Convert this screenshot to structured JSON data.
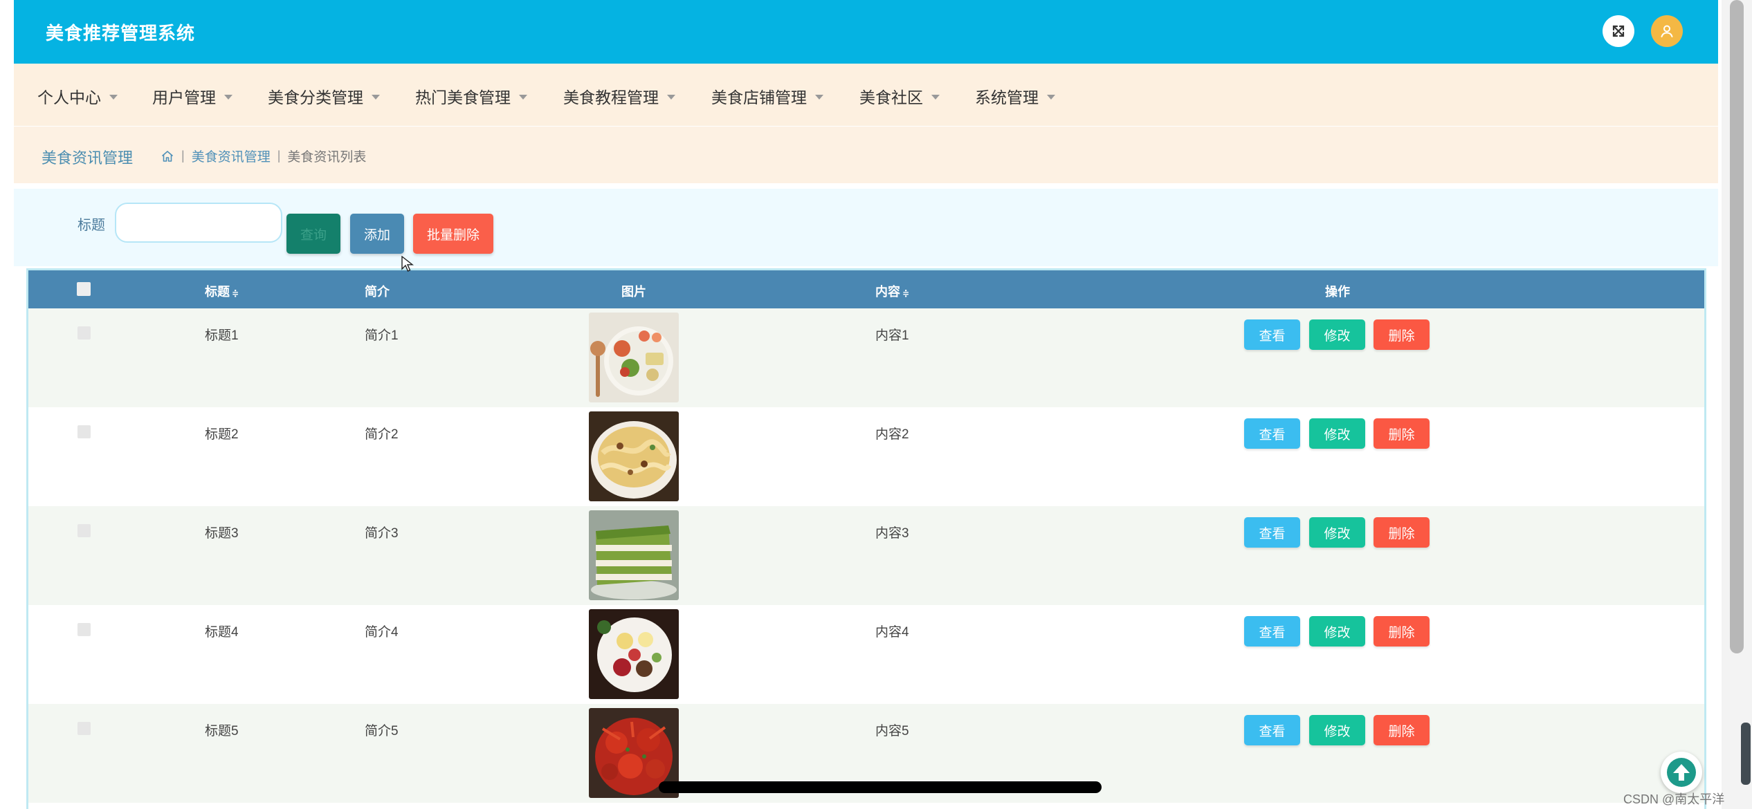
{
  "header": {
    "title": "美食推荐管理系统"
  },
  "nav": {
    "items": [
      {
        "label": "个人中心"
      },
      {
        "label": "用户管理"
      },
      {
        "label": "美食分类管理"
      },
      {
        "label": "热门美食管理"
      },
      {
        "label": "美食教程管理"
      },
      {
        "label": "美食店铺管理"
      },
      {
        "label": "美食社区"
      },
      {
        "label": "系统管理"
      }
    ]
  },
  "breadcrumb": {
    "title": "美食资讯管理",
    "sep": "|",
    "level1": "美食资讯管理",
    "level2": "美食资讯列表"
  },
  "search": {
    "label": "标题",
    "value": "",
    "placeholder": "",
    "search_button": "查询",
    "add_button": "添加",
    "batch_delete_button": "批量删除"
  },
  "table": {
    "columns": {
      "title": "标题",
      "intro": "简介",
      "image": "图片",
      "content": "内容",
      "actions": "操作",
      "sort_icon": "≑"
    },
    "rows": [
      {
        "title": "标题1",
        "intro": "简介1",
        "content": "内容1",
        "image": "salad-plate-photo"
      },
      {
        "title": "标题2",
        "intro": "简介2",
        "content": "内容2",
        "image": "noodle-dish-photo"
      },
      {
        "title": "标题3",
        "intro": "简介3",
        "content": "内容3",
        "image": "matcha-cake-photo"
      },
      {
        "title": "标题4",
        "intro": "简介4",
        "content": "内容4",
        "image": "dessert-plate-photo"
      },
      {
        "title": "标题5",
        "intro": "简介5",
        "content": "内容5",
        "image": "crayfish-photo"
      }
    ],
    "actions": {
      "view": "查看",
      "edit": "修改",
      "delete": "删除"
    }
  },
  "watermark": "CSDN @南太平洋",
  "icons": [
    "fullscreen-icon",
    "user-icon",
    "home-icon",
    "back-to-top-icon",
    "mouse-cursor-icon"
  ],
  "colors": {
    "topbar": "#05b3e2",
    "navbar": "#fdf0e0",
    "table_header": "#4a87b2",
    "view_button": "#3bbdf0",
    "edit_button": "#16c39c",
    "delete_button": "#fb5843",
    "add_button": "#4a8ab3",
    "search_button": "#14806b"
  }
}
